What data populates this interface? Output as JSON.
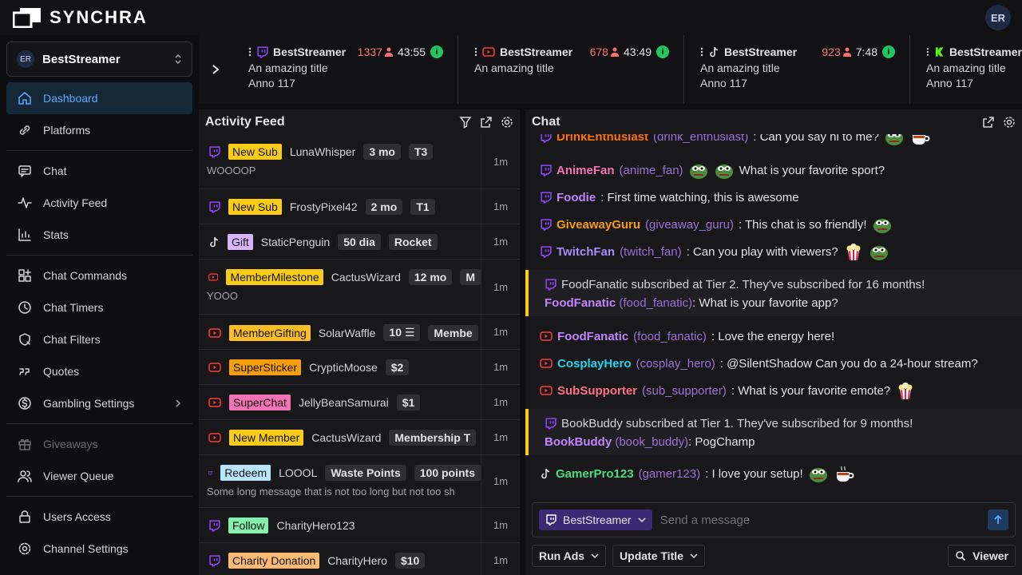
{
  "app": {
    "name": "SYNCHRA",
    "user_initials": "ER"
  },
  "colors": {
    "accent": "#5aa8ff",
    "twitch": "#9146ff",
    "youtube": "#ff3b3b",
    "kick": "#53fc18",
    "live": "#22c55e",
    "viewers": "#f87171"
  },
  "sidebar": {
    "account": {
      "initials": "ER",
      "name": "BestStreamer"
    },
    "items": [
      {
        "label": "Dashboard",
        "icon": "home-icon"
      },
      {
        "label": "Platforms",
        "icon": "link-icon"
      },
      {
        "label": "Chat",
        "icon": "chat-icon"
      },
      {
        "label": "Activity Feed",
        "icon": "activity-icon"
      },
      {
        "label": "Stats",
        "icon": "chart-icon"
      },
      {
        "label": "Chat Commands",
        "icon": "commands-icon"
      },
      {
        "label": "Chat Timers",
        "icon": "clock-icon"
      },
      {
        "label": "Chat Filters",
        "icon": "filter-icon"
      },
      {
        "label": "Quotes",
        "icon": "quote-icon"
      },
      {
        "label": "Gambling Settings",
        "icon": "dollar-icon"
      },
      {
        "label": "Giveaways",
        "icon": "gift-icon"
      },
      {
        "label": "Viewer Queue",
        "icon": "users-icon"
      },
      {
        "label": "Users Access",
        "icon": "lock-icon"
      },
      {
        "label": "Channel Settings",
        "icon": "gear-icon"
      }
    ]
  },
  "streams": [
    {
      "platform": "twitch",
      "name": "BestStreamer",
      "viewers": "1337",
      "uptime": "43:55",
      "title": "An amazing title",
      "game": "Anno 117"
    },
    {
      "platform": "youtube",
      "name": "BestStreamer",
      "viewers": "678",
      "uptime": "43:49",
      "title": "An amazing title",
      "game": ""
    },
    {
      "platform": "tiktok",
      "name": "BestStreamer",
      "viewers": "923",
      "uptime": "7:48",
      "title": "An amazing title",
      "game": "Anno 117"
    },
    {
      "platform": "kick",
      "name": "BestStreamer",
      "viewers": "",
      "uptime": "",
      "title": "An amazing title",
      "game": "Anno 117"
    }
  ],
  "activity": {
    "title": "Activity Feed",
    "rows": [
      {
        "platform": "twitch",
        "type": "New Sub",
        "type_color": "#facc15",
        "user": "LunaWhisper",
        "chips": [
          "3 mo",
          "T3"
        ],
        "message": "WOOOOP",
        "time": "1m"
      },
      {
        "platform": "twitch",
        "type": "New Sub",
        "type_color": "#facc15",
        "user": "FrostyPixel42",
        "chips": [
          "2 mo",
          "T1"
        ],
        "message": "",
        "time": "1m"
      },
      {
        "platform": "tiktok",
        "type": "Gift",
        "type_color": "#d8b4fe",
        "user": "StaticPenguin",
        "chips": [
          "50 dia",
          "Rocket"
        ],
        "message": "",
        "time": "1m"
      },
      {
        "platform": "youtube",
        "type": "MemberMilestone",
        "type_color": "#facc15",
        "user": "CactusWizard",
        "chips": [
          "12 mo",
          "M"
        ],
        "message": "YOOO",
        "time": "1m"
      },
      {
        "platform": "youtube",
        "type": "MemberGifting",
        "type_color": "#fbbf24",
        "user": "SolarWaffle",
        "chips": [
          "10 ☰",
          "Membe"
        ],
        "message": "",
        "time": "1m"
      },
      {
        "platform": "youtube",
        "type": "SuperSticker",
        "type_color": "#f59e0b",
        "user": "CrypticMoose",
        "chips": [
          "$2"
        ],
        "message": "",
        "time": "1m"
      },
      {
        "platform": "youtube",
        "type": "SuperChat",
        "type_color": "#f472b6",
        "user": "JellyBeanSamurai",
        "chips": [
          "$1"
        ],
        "message": "",
        "time": "1m"
      },
      {
        "platform": "youtube",
        "type": "New Member",
        "type_color": "#facc15",
        "user": "CactusWizard",
        "chips": [
          "Membership T"
        ],
        "message": "",
        "time": "1m"
      },
      {
        "platform": "twitch",
        "type": "Redeem",
        "type_color": "#bae6fd",
        "user": "LOOOL",
        "chips": [
          "Waste Points",
          "100 points"
        ],
        "message": "Some long message that is not too long but not too sh",
        "time": "1m"
      },
      {
        "platform": "twitch",
        "type": "Follow",
        "type_color": "#86efac",
        "user": "CharityHero123",
        "chips": [],
        "message": "",
        "time": "1m"
      },
      {
        "platform": "twitch",
        "type": "Charity Donation",
        "type_color": "#fdba74",
        "user": "CharityHero",
        "chips": [
          "$10"
        ],
        "message": "",
        "time": "1m"
      }
    ]
  },
  "chat": {
    "title": "Chat",
    "messages": [
      {
        "platform": "twitch",
        "user": "DrinkEnthusiast",
        "handle": "(drink_enthusiast)",
        "color": "#f97316",
        "text": ": Can you say hi to me?",
        "emotes_after": [
          "pepe-emote",
          "tea-emote"
        ],
        "emotes_before": []
      },
      {
        "platform": "twitch",
        "user": "AnimeFan",
        "handle": "(anime_fan)",
        "color": "#f472b6",
        "text": "What is your favorite sport?",
        "emotes_before": [
          "pepe-emote",
          "pepe-emote"
        ],
        "emotes_after": []
      },
      {
        "platform": "twitch",
        "user": "Foodie",
        "handle": "",
        "color": "#c084fc",
        "text": ": First time watching, this is awesome",
        "emotes_before": [],
        "emotes_after": []
      },
      {
        "platform": "twitch",
        "user": "GiveawayGuru",
        "handle": "(giveaway_guru)",
        "color": "#f59e0b",
        "text": ": This chat is so friendly!",
        "emotes_before": [],
        "emotes_after": [
          "pepe-emote"
        ]
      },
      {
        "platform": "twitch",
        "user": "TwitchFan",
        "handle": "(twitch_fan)",
        "color": "#a78bfa",
        "text": ": Can you play with viewers?",
        "emotes_before": [],
        "emotes_after": [
          "popcorn-emote",
          "pepe-emote"
        ]
      }
    ],
    "sub1": {
      "notice": "FoodFanatic subscribed at Tier 2. They've subscribed for 16 months!",
      "user": "FoodFanatic",
      "handle": "(food_fanatic)",
      "color": "#c084fc",
      "text": ": What is your favorite app?"
    },
    "messages2": [
      {
        "platform": "youtube",
        "user": "FoodFanatic",
        "handle": "(food_fanatic)",
        "color": "#c084fc",
        "text": ": Love the energy here!",
        "emotes_after": []
      },
      {
        "platform": "youtube",
        "user": "CosplayHero",
        "handle": "(cosplay_hero)",
        "color": "#22d3ee",
        "text": ": @SilentShadow Can you do a 24-hour stream?",
        "emotes_after": []
      },
      {
        "platform": "youtube",
        "user": "SubSupporter",
        "handle": "(sub_supporter)",
        "color": "#fb7185",
        "text": ": What is your favorite emote?",
        "emotes_after": [
          "popcorn-emote"
        ]
      }
    ],
    "sub2": {
      "notice": "BookBuddy subscribed at Tier 1. They've subscribed for 9 months!",
      "user": "BookBuddy",
      "handle": "(book_buddy)",
      "color": "#c084fc",
      "text": ": PogChamp"
    },
    "last": {
      "platform": "tiktok",
      "user": "GamerPro123",
      "handle": "(gamer123)",
      "color": "#4ade80",
      "text": ": I love your setup!",
      "emotes_after": [
        "pepe-emote",
        "tea-emote"
      ]
    },
    "input": {
      "account": "BestStreamer",
      "placeholder": "Send a message"
    },
    "actions": {
      "run_ads": "Run Ads",
      "update_title": "Update Title",
      "viewer": "Viewer"
    }
  }
}
